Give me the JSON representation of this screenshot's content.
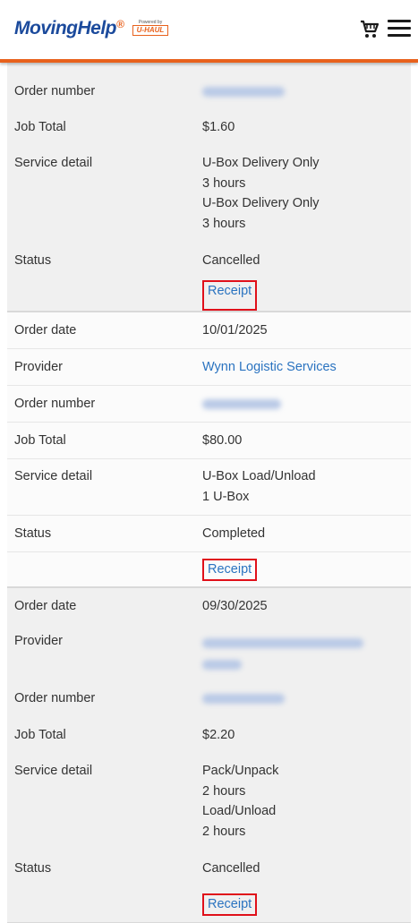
{
  "header": {
    "logo_text": "MovingHelp",
    "logo_mark": "®",
    "partner_powered": "Powered by",
    "partner_name": "U-HAUL"
  },
  "orders": [
    {
      "order_number_label": "Order number",
      "job_total_label": "Job Total",
      "job_total": "$1.60",
      "service_detail_label": "Service detail",
      "service_detail": [
        "U-Box Delivery Only",
        "3 hours",
        "U-Box Delivery Only",
        "3 hours"
      ],
      "status_label": "Status",
      "status": "Cancelled",
      "receipt_label": "Receipt"
    },
    {
      "order_date_label": "Order date",
      "order_date": "10/01/2025",
      "provider_label": "Provider",
      "provider": "Wynn Logistic Services",
      "order_number_label": "Order number",
      "job_total_label": "Job Total",
      "job_total": "$80.00",
      "service_detail_label": "Service detail",
      "service_detail": [
        "U-Box Load/Unload",
        "1 U-Box"
      ],
      "status_label": "Status",
      "status": "Completed",
      "receipt_label": "Receipt"
    },
    {
      "order_date_label": "Order date",
      "order_date": "09/30/2025",
      "provider_label": "Provider",
      "order_number_label": "Order number",
      "job_total_label": "Job Total",
      "job_total": "$2.20",
      "service_detail_label": "Service detail",
      "service_detail": [
        "Pack/Unpack",
        "2 hours",
        "Load/Unload",
        "2 hours"
      ],
      "status_label": "Status",
      "status": "Cancelled",
      "receipt_label": "Receipt"
    }
  ],
  "icons": {
    "cart": "shopping-cart-icon",
    "menu": "hamburger-menu-icon"
  },
  "colors": {
    "accent": "#e8611c",
    "brand": "#1b4a9c",
    "link": "#2a73c0",
    "highlight": "#e0101a"
  }
}
